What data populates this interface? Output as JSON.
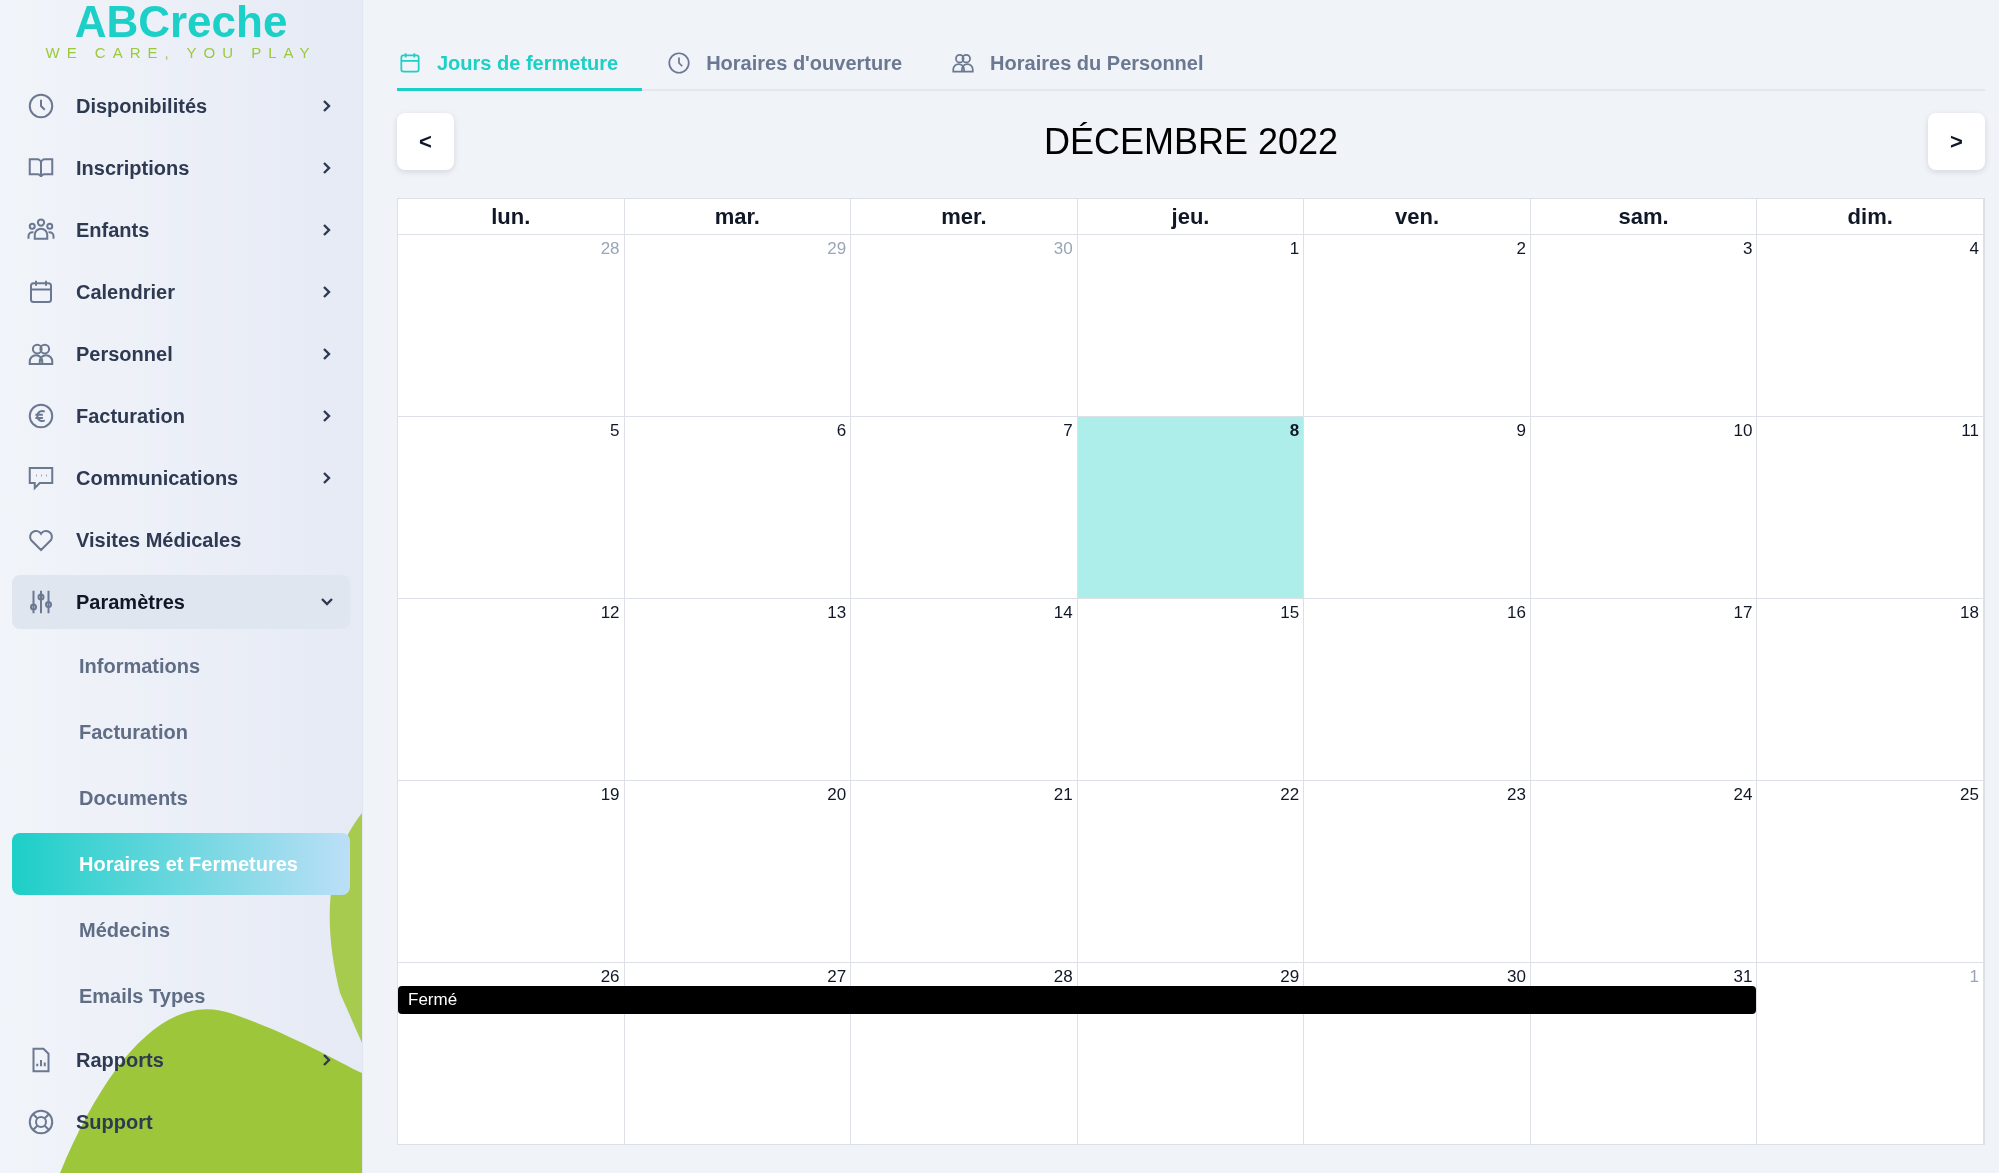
{
  "logo": {
    "name": "ABCreche",
    "tagline": "WE CARE, YOU PLAY"
  },
  "sidebar": {
    "items": [
      {
        "label": "Disponibilités",
        "expandable": true,
        "expanded": false
      },
      {
        "label": "Inscriptions",
        "expandable": true,
        "expanded": false
      },
      {
        "label": "Enfants",
        "expandable": true,
        "expanded": false
      },
      {
        "label": "Calendrier",
        "expandable": true,
        "expanded": false
      },
      {
        "label": "Personnel",
        "expandable": true,
        "expanded": false
      },
      {
        "label": "Facturation",
        "expandable": true,
        "expanded": false
      },
      {
        "label": "Communications",
        "expandable": true,
        "expanded": false
      },
      {
        "label": "Visites Médicales",
        "expandable": false,
        "expanded": false
      },
      {
        "label": "Paramètres",
        "expandable": true,
        "expanded": true,
        "children": [
          {
            "label": "Informations",
            "selected": false
          },
          {
            "label": "Facturation",
            "selected": false
          },
          {
            "label": "Documents",
            "selected": false
          },
          {
            "label": "Horaires et Fermetures",
            "selected": true
          },
          {
            "label": "Médecins",
            "selected": false
          },
          {
            "label": "Emails Types",
            "selected": false
          }
        ]
      },
      {
        "label": "Rapports",
        "expandable": true,
        "expanded": false
      },
      {
        "label": "Support",
        "expandable": false,
        "expanded": false
      }
    ]
  },
  "tabs": [
    {
      "label": "Jours de fermeture",
      "selected": true
    },
    {
      "label": "Horaires d'ouverture",
      "selected": false
    },
    {
      "label": "Horaires du Personnel",
      "selected": false
    }
  ],
  "calendar": {
    "prev": "<",
    "next": ">",
    "title": "DÉCEMBRE 2022",
    "weekdays": [
      "lun.",
      "mar.",
      "mer.",
      "jeu.",
      "ven.",
      "sam.",
      "dim."
    ],
    "weeks": [
      {
        "days": [
          {
            "day": "28",
            "outside": true,
            "today": false,
            "closed": false
          },
          {
            "day": "29",
            "outside": true,
            "today": false,
            "closed": false
          },
          {
            "day": "30",
            "outside": true,
            "today": false,
            "closed": false
          },
          {
            "day": "1",
            "outside": false,
            "today": false,
            "closed": false
          },
          {
            "day": "2",
            "outside": false,
            "today": false,
            "closed": false
          },
          {
            "day": "3",
            "outside": false,
            "today": false,
            "closed": false
          },
          {
            "day": "4",
            "outside": false,
            "today": false,
            "closed": false
          }
        ]
      },
      {
        "days": [
          {
            "day": "5",
            "outside": false,
            "today": false,
            "closed": false
          },
          {
            "day": "6",
            "outside": false,
            "today": false,
            "closed": false
          },
          {
            "day": "7",
            "outside": false,
            "today": false,
            "closed": false
          },
          {
            "day": "8",
            "outside": false,
            "today": true,
            "closed": false
          },
          {
            "day": "9",
            "outside": false,
            "today": false,
            "closed": false
          },
          {
            "day": "10",
            "outside": false,
            "today": false,
            "closed": false
          },
          {
            "day": "11",
            "outside": false,
            "today": false,
            "closed": false
          }
        ]
      },
      {
        "days": [
          {
            "day": "12",
            "outside": false,
            "today": false,
            "closed": false
          },
          {
            "day": "13",
            "outside": false,
            "today": false,
            "closed": false
          },
          {
            "day": "14",
            "outside": false,
            "today": false,
            "closed": false
          },
          {
            "day": "15",
            "outside": false,
            "today": false,
            "closed": false
          },
          {
            "day": "16",
            "outside": false,
            "today": false,
            "closed": false
          },
          {
            "day": "17",
            "outside": false,
            "today": false,
            "closed": false
          },
          {
            "day": "18",
            "outside": false,
            "today": false,
            "closed": false
          }
        ]
      },
      {
        "days": [
          {
            "day": "19",
            "outside": false,
            "today": false,
            "closed": false
          },
          {
            "day": "20",
            "outside": false,
            "today": false,
            "closed": false
          },
          {
            "day": "21",
            "outside": false,
            "today": false,
            "closed": false
          },
          {
            "day": "22",
            "outside": false,
            "today": false,
            "closed": false
          },
          {
            "day": "23",
            "outside": false,
            "today": false,
            "closed": false
          },
          {
            "day": "24",
            "outside": false,
            "today": false,
            "closed": false
          },
          {
            "day": "25",
            "outside": false,
            "today": false,
            "closed": false
          }
        ]
      },
      {
        "closure_label": "Fermé",
        "days": [
          {
            "day": "26",
            "outside": false,
            "today": false,
            "closed": true
          },
          {
            "day": "27",
            "outside": false,
            "today": false,
            "closed": true
          },
          {
            "day": "28",
            "outside": false,
            "today": false,
            "closed": true
          },
          {
            "day": "29",
            "outside": false,
            "today": false,
            "closed": true
          },
          {
            "day": "30",
            "outside": false,
            "today": false,
            "closed": true
          },
          {
            "day": "31",
            "outside": false,
            "today": false,
            "closed": true
          },
          {
            "day": "1",
            "outside": true,
            "today": false,
            "closed": false
          }
        ]
      }
    ]
  }
}
